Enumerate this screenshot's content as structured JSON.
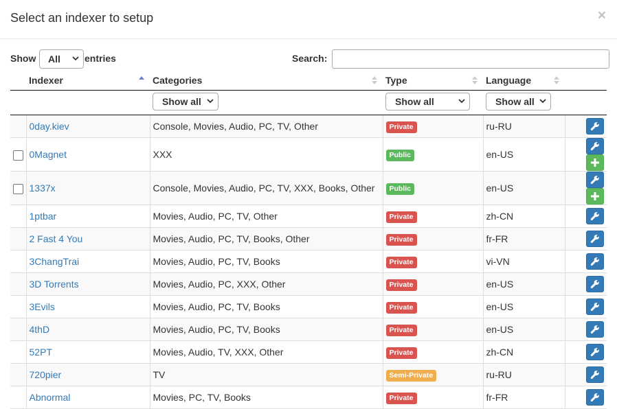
{
  "modal": {
    "title": "Select an indexer to setup",
    "close_symbol": "×"
  },
  "controls": {
    "show_label": "Show",
    "entries_value": "All",
    "entries_label": "entries",
    "search_label": "Search:",
    "search_value": ""
  },
  "columns": [
    "Indexer",
    "Categories",
    "Type",
    "Language"
  ],
  "filters": {
    "categories": "Show all",
    "type": "Show all",
    "language": "Show all"
  },
  "colors": {
    "link": "#337ab7",
    "private": "#d9534f",
    "public": "#5cb85c",
    "semi_private": "#f0ad4e",
    "action_blue": "#337ab7",
    "action_green": "#5cb85c"
  },
  "rows": [
    {
      "name": "0day.kiev",
      "categories": "Console, Movies, Audio, PC, TV, Other",
      "type": "Private",
      "language": "ru-RU"
    },
    {
      "name": "0Magnet",
      "categories": "XXX",
      "type": "Public",
      "language": "en-US"
    },
    {
      "name": "1337x",
      "categories": "Console, Movies, Audio, PC, TV, XXX, Books, Other",
      "type": "Public",
      "language": "en-US"
    },
    {
      "name": "1ptbar",
      "categories": "Movies, Audio, PC, TV, Other",
      "type": "Private",
      "language": "zh-CN"
    },
    {
      "name": "2 Fast 4 You",
      "categories": "Movies, Audio, PC, TV, Books, Other",
      "type": "Private",
      "language": "fr-FR"
    },
    {
      "name": "3ChangTrai",
      "categories": "Movies, Audio, PC, TV, Books",
      "type": "Private",
      "language": "vi-VN"
    },
    {
      "name": "3D Torrents",
      "categories": "Movies, Audio, PC, XXX, Other",
      "type": "Private",
      "language": "en-US"
    },
    {
      "name": "3Evils",
      "categories": "Movies, Audio, PC, TV, Books",
      "type": "Private",
      "language": "en-US"
    },
    {
      "name": "4thD",
      "categories": "Movies, Audio, PC, TV, Books",
      "type": "Private",
      "language": "en-US"
    },
    {
      "name": "52PT",
      "categories": "Movies, Audio, TV, XXX, Other",
      "type": "Private",
      "language": "zh-CN"
    },
    {
      "name": "720pier",
      "categories": "TV",
      "type": "Semi-Private",
      "language": "ru-RU"
    },
    {
      "name": "Abnormal",
      "categories": "Movies, PC, TV, Books",
      "type": "Private",
      "language": "fr-FR"
    }
  ]
}
